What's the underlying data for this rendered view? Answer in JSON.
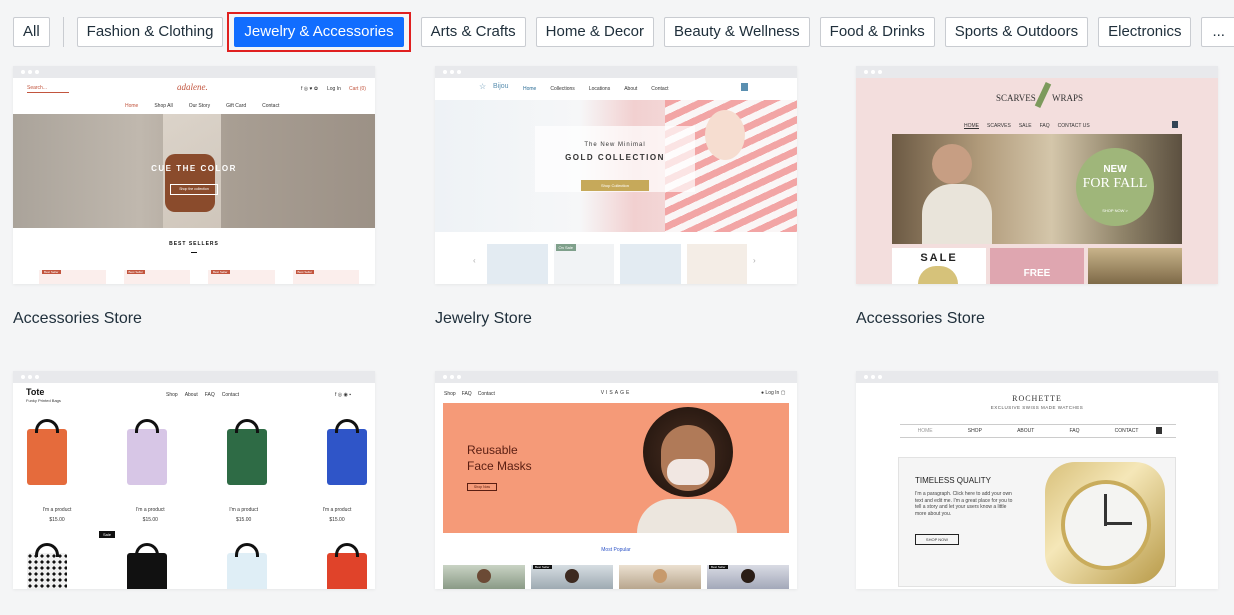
{
  "filters": {
    "all": "All",
    "items": [
      "Fashion & Clothing",
      "Jewelry & Accessories",
      "Arts & Crafts",
      "Home & Decor",
      "Beauty & Wellness",
      "Food & Drinks",
      "Sports & Outdoors",
      "Electronics"
    ],
    "more": "...",
    "active": "Jewelry & Accessories"
  },
  "colors": {
    "active_chip": "#116dff",
    "highlight_border": "#e0201f",
    "page_bg": "#f4f5f6"
  },
  "templates": [
    {
      "title": "Accessories Store",
      "preview": {
        "search": "Search...",
        "brand": "adalene.",
        "login": "Log In",
        "cart": "Cart (0)",
        "nav": [
          "Home",
          "Shop All",
          "Our Story",
          "Gift Card",
          "Contact"
        ],
        "hero": "CUE THE COLOR",
        "cta": "Shop the collection",
        "section": "BEST SELLERS",
        "badge": "Best Seller"
      }
    },
    {
      "title": "Jewelry Store",
      "preview": {
        "brand": "Bijou",
        "nav": [
          "Home",
          "Collections",
          "Locations",
          "About",
          "Contact"
        ],
        "hero_line1": "The New Minimal",
        "hero_line2": "GOLD COLLECTION",
        "cta": "Shop Collection",
        "badge": "On Sale"
      }
    },
    {
      "title": "Accessories Store",
      "preview": {
        "brand_left": "SCARVES",
        "brand_right": "WRAPS",
        "nav": [
          "HOME",
          "SCARVES",
          "SALE",
          "FAQ",
          "CONTACT US"
        ],
        "badge_line1": "NEW",
        "badge_line2": "FOR FALL",
        "badge_cta": "SHOP NOW >",
        "tile1": "SALE",
        "tile2": "FREE"
      }
    },
    {
      "title": "",
      "preview": {
        "brand": "Tote",
        "tagline": "Funky Printed Bags",
        "nav": [
          "Shop",
          "About",
          "FAQ",
          "Contact"
        ],
        "product": "I'm a product",
        "price": "$15.00",
        "badge": "Sale"
      }
    },
    {
      "title": "",
      "preview": {
        "nav": [
          "Shop",
          "FAQ",
          "Contact"
        ],
        "brand": "VISAGE",
        "hero_line1": "Reusable",
        "hero_line2": "Face Masks",
        "cta": "Shop Now",
        "section": "Most Popular",
        "badge": "Best Seller"
      }
    },
    {
      "title": "",
      "preview": {
        "brand": "ROCHETTE",
        "tagline": "EXCLUSIVE SWISS MADE WATCHES",
        "nav": [
          "HOME",
          "SHOP",
          "ABOUT",
          "FAQ",
          "CONTACT"
        ],
        "heading": "TIMELESS QUALITY",
        "body": "I'm a paragraph. Click here to add your own text and edit me. I'm a great place for you to tell a story and let your users know a little more about you.",
        "cta": "SHOP NOW"
      }
    }
  ]
}
